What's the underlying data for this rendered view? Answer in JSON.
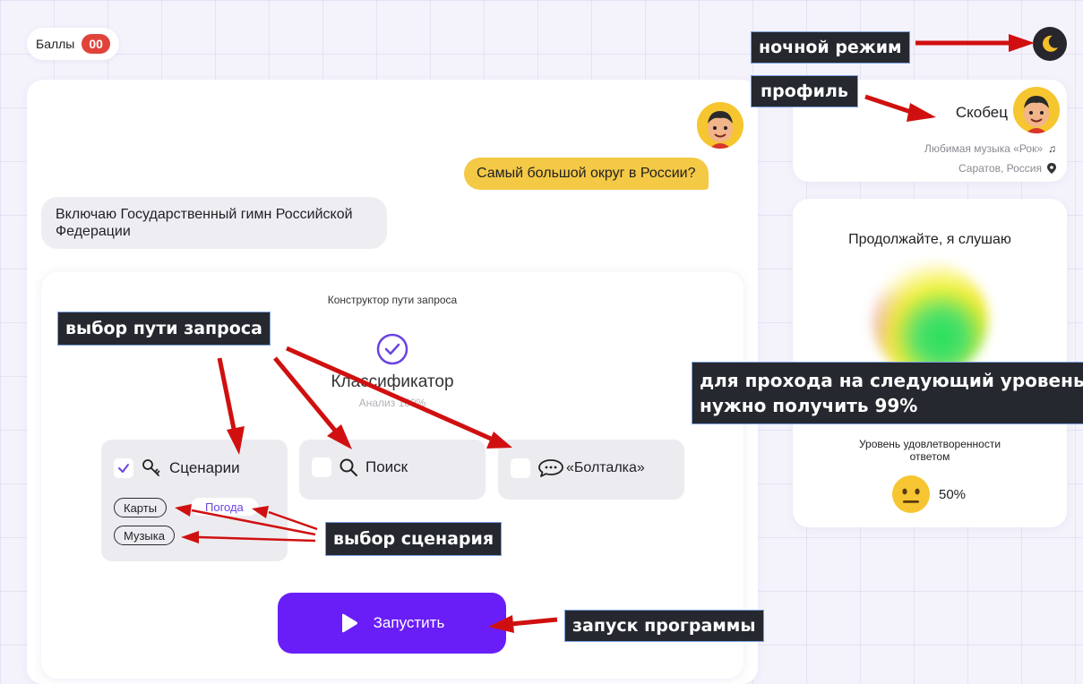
{
  "score": {
    "label": "Баллы",
    "value": "00"
  },
  "chat": {
    "user_message": "Самый большой округ в России?",
    "bot_message": "Включаю Государственный гимн Российской Федерации"
  },
  "constructor": {
    "title": "Конструктор пути запроса",
    "classifier": {
      "title": "Классификатор",
      "subtitle": "Анализ 100%"
    },
    "routes": [
      {
        "label": "Сценарии",
        "icon": "key-icon",
        "checked": true
      },
      {
        "label": "Поиск",
        "icon": "search-icon",
        "checked": false
      },
      {
        "label": "«Болталка»",
        "icon": "chat-bubble-icon",
        "checked": false
      }
    ],
    "scenarios": [
      {
        "label": "Карты",
        "selected": true
      },
      {
        "label": "Погода",
        "selected": false
      },
      {
        "label": "Музыка",
        "selected": true
      }
    ],
    "run_label": "Запустить"
  },
  "profile": {
    "name": "Скобец",
    "music": "Любимая музыка «Рок»",
    "location": "Саратов, Россия"
  },
  "assistant": {
    "status": "Продолжайте, я слушаю",
    "satisfaction_label": "Уровень удовлетворенности ответом",
    "satisfaction_value": "50%"
  },
  "annotations": {
    "night_mode": "ночной режим",
    "profile": "профиль",
    "route_choice": "выбор пути запроса",
    "scenario_choice": "выбор сценария",
    "level_hint_line1": "для прохода на следующий уровень",
    "level_hint_line2": "нужно получить 99%",
    "launch": "запуск программы"
  },
  "colors": {
    "accent": "#6a1ef7",
    "user_bubble": "#f4c945",
    "badge": "#e0433a",
    "annotation_arrow": "#d01010"
  }
}
